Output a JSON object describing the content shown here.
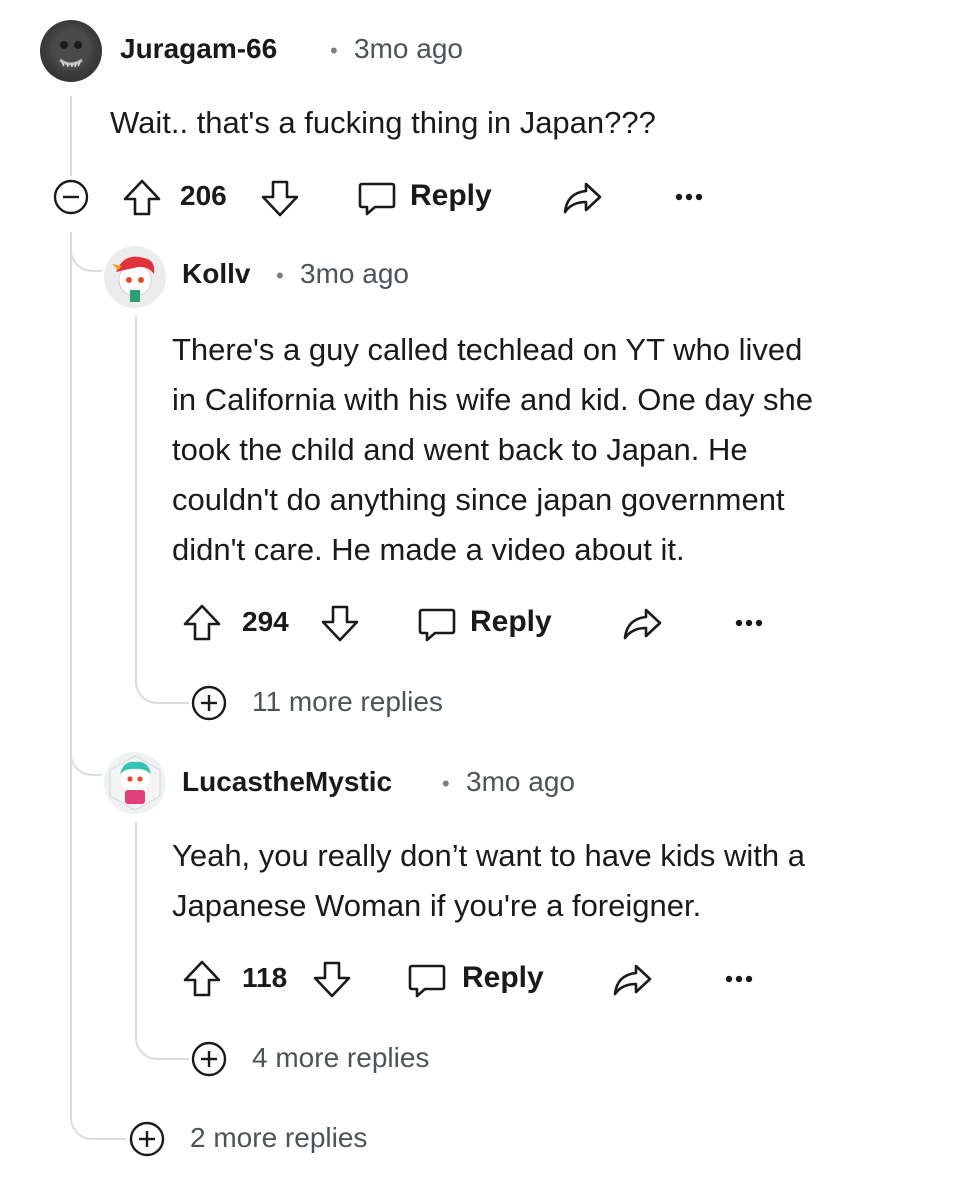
{
  "comments": [
    {
      "username": "Juragam-66",
      "time": "3mo ago",
      "body": "Wait.. that's a fucking thing in Japan???",
      "score": "206",
      "reply_label": "Reply"
    },
    {
      "username": "Kollv",
      "time": "3mo ago",
      "body_lines": [
        "There's a guy called techlead on YT who lived",
        "in California with his wife and kid. One day she",
        "took the child and went back to Japan. He",
        "couldn't do anything since japan government",
        "didn't care. He made a video about it."
      ],
      "score": "294",
      "reply_label": "Reply",
      "more_replies": "11 more replies"
    },
    {
      "username": "LucastheMystic",
      "time": "3mo ago",
      "body_lines": [
        "Yeah, you really don’t want to have kids with a",
        "Japanese Woman if you're a foreigner."
      ],
      "score": "118",
      "reply_label": "Reply",
      "more_replies": "4 more replies"
    }
  ],
  "thread_more_replies": "2 more replies",
  "separator": "•",
  "icons": {
    "collapse": "minus-circle-icon",
    "upvote": "arrow-up-icon",
    "downvote": "arrow-down-icon",
    "reply": "speech-bubble-icon",
    "share": "share-arrow-icon",
    "overflow": "ellipsis-icon",
    "expand": "plus-circle-icon"
  },
  "colors": {
    "thread_line": "#dadde0",
    "meta_text": "#4d5358"
  }
}
